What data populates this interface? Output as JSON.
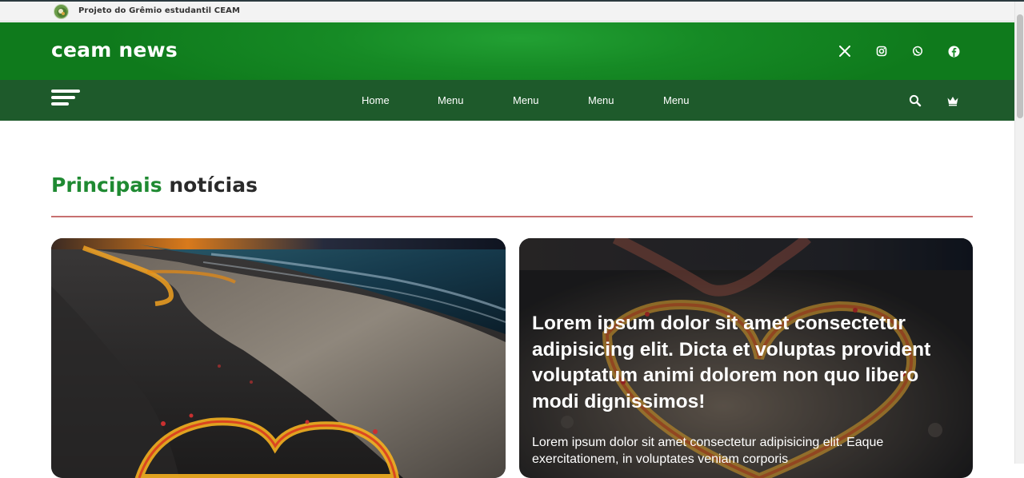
{
  "topbar": {
    "project_label": "Projeto do Grêmio estudantil CEAM",
    "logo_icon": "school-logo-icon"
  },
  "header": {
    "brand": "ceam news",
    "social": [
      {
        "name": "x-twitter-icon"
      },
      {
        "name": "instagram-icon"
      },
      {
        "name": "whatsapp-icon"
      },
      {
        "name": "facebook-icon"
      }
    ]
  },
  "nav": {
    "menu_icon": "hamburger-menu-icon",
    "items": [
      "Home",
      "Menu",
      "Menu",
      "Menu",
      "Menu"
    ],
    "search_icon": "search-icon",
    "crown_icon": "crown-icon"
  },
  "section": {
    "title_accent": "Principais",
    "title_rest": "notícias"
  },
  "cards": [
    {
      "image": "night-beach-shoreline-image"
    },
    {
      "image": "glowing-heart-sand-image",
      "headline": "Lorem ipsum dolor sit amet consectetur adipisicing elit. Dicta et voluptas provident voluptatum animi dolorem non quo libero modi dignissimos!",
      "excerpt": "Lorem ipsum dolor sit amet consectetur adipisicing elit. Eaque exercitationem, in voluptates veniam corporis"
    }
  ],
  "colors": {
    "header_green": "#168a25",
    "nav_green": "#1e5a2b",
    "accent_green": "#1f8a32",
    "divider_red": "#c77070"
  }
}
